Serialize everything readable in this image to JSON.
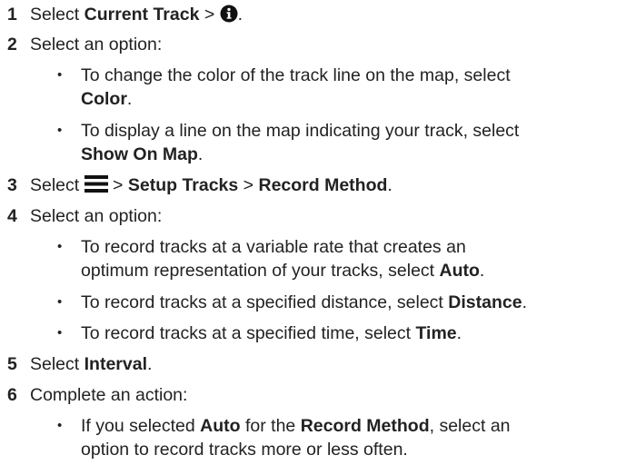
{
  "steps": [
    {
      "number": "1",
      "parts": [
        "Select ",
        "Current Track",
        " > ",
        "."
      ],
      "icon": "info-icon"
    },
    {
      "number": "2",
      "text": "Select an option:",
      "bullets": [
        {
          "line1": "To change the color of the track line on the map, select",
          "line2_bold": "Color",
          "line2_end": "."
        },
        {
          "line1": "To display a line on the map indicating your track, select",
          "line2_bold": "Show On Map",
          "line2_end": "."
        }
      ]
    },
    {
      "number": "3",
      "parts": [
        "Select ",
        " > ",
        "Setup Tracks",
        " > ",
        "Record Method",
        "."
      ],
      "icon": "menu-icon"
    },
    {
      "number": "4",
      "text": "Select an option:",
      "bullets": [
        {
          "line1": "To record tracks at a variable rate that creates an",
          "line2_start": "optimum representation of your tracks, select ",
          "line2_bold": "Auto",
          "line2_end": "."
        },
        {
          "start": "To record tracks at a specified distance, select ",
          "bold": "Distance",
          "end": "."
        },
        {
          "start": "To record tracks at a specified time, select ",
          "bold": "Time",
          "end": "."
        }
      ]
    },
    {
      "number": "5",
      "parts": [
        "Select ",
        "Interval",
        "."
      ]
    },
    {
      "number": "6",
      "text": "Complete an action:",
      "bullets": [
        {
          "start": "If you selected ",
          "bold1": "Auto",
          "mid": " for the ",
          "bold2": "Record Method",
          "end": ", select an",
          "line2": "option to record tracks more or less often."
        }
      ]
    }
  ],
  "bullet_char": "•"
}
